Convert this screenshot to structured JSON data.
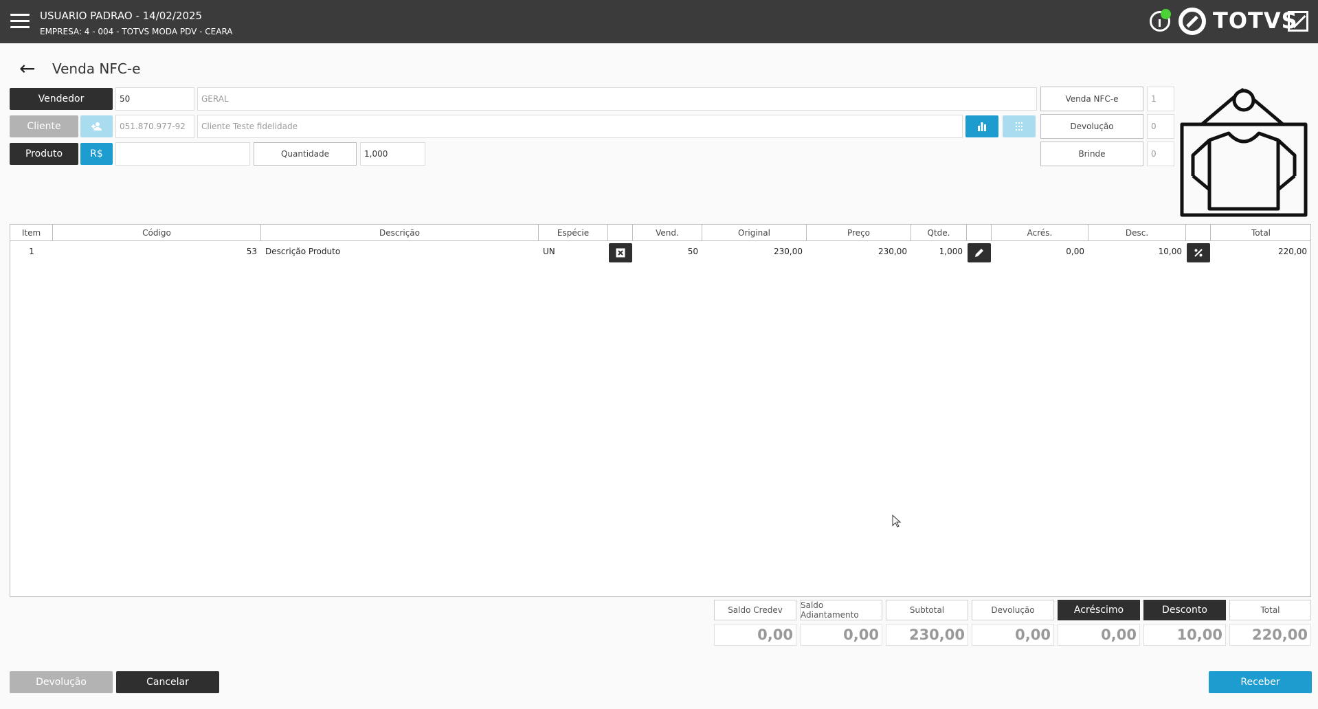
{
  "header": {
    "user_line": "USUARIO PADRAO - 14/02/2025",
    "company_line": "EMPRESA: 4 - 004 - TOTVS MODA PDV - CEARA",
    "logo_text": "TOTVS",
    "icons": [
      "menu-icon",
      "info-icon",
      "totvs-logo-icon",
      "expand-icon"
    ]
  },
  "page": {
    "title": "Venda NFC-e"
  },
  "form": {
    "vendedor_label": "Vendedor",
    "vendedor_code": "50",
    "vendedor_name": "GERAL",
    "cliente_label": "Cliente",
    "cliente_doc": "051.870.977-92",
    "cliente_name": "Cliente Teste fidelidade",
    "produto_label": "Produto",
    "produto_price_btn": "R$",
    "produto_value": "",
    "quantidade_label": "Quantidade",
    "quantidade_value": "1,000"
  },
  "counters": [
    {
      "label": "Venda NFC-e",
      "value": "1"
    },
    {
      "label": "Devolução",
      "value": "0"
    },
    {
      "label": "Brinde",
      "value": "0"
    }
  ],
  "table": {
    "columns": [
      "Item",
      "Código",
      "Descrição",
      "Espécie",
      "",
      "Vend.",
      "Original",
      "Preço",
      "Qtde.",
      "",
      "Acrés.",
      "Desc.",
      "",
      "Total"
    ],
    "rows": [
      {
        "item": "1",
        "codigo": "53",
        "descricao": "Descrição Produto",
        "especie": "UN",
        "vend": "50",
        "original": "230,00",
        "preco": "230,00",
        "qtde": "1,000",
        "acres": "0,00",
        "desc": "10,00",
        "total": "220,00"
      }
    ]
  },
  "totals": {
    "labels": [
      "Saldo Credev",
      "Saldo Adiantamento",
      "Subtotal",
      "Devolução",
      "Acréscimo",
      "Desconto",
      "Total"
    ],
    "values": [
      "0,00",
      "0,00",
      "230,00",
      "0,00",
      "0,00",
      "10,00",
      "220,00"
    ]
  },
  "footer": {
    "devolucao": "Devolução",
    "cancelar": "Cancelar",
    "receber": "Receber"
  },
  "colors": {
    "header_bg": "#3b3b3b",
    "dark_button": "#2f2f2f",
    "accent_blue": "#1d9ccf",
    "status_green": "#4cd137"
  }
}
